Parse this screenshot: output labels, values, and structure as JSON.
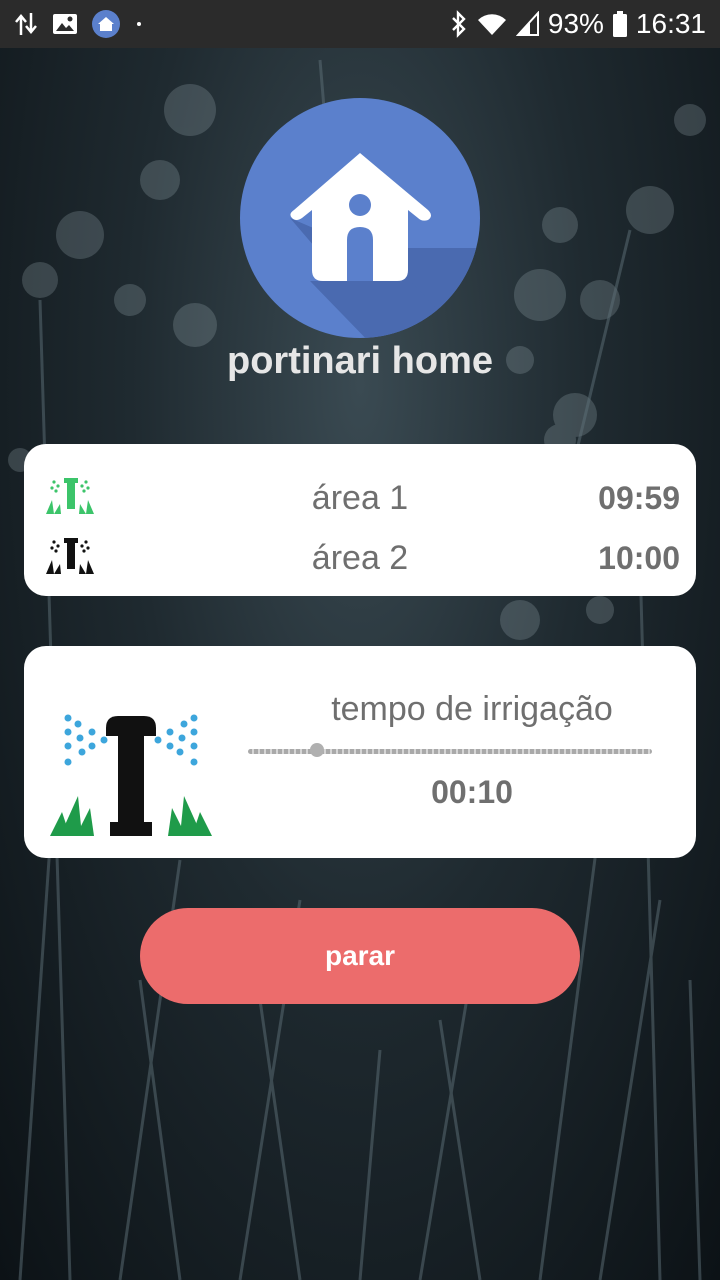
{
  "status_bar": {
    "left_icons": [
      "data-sync-icon",
      "image-icon",
      "app-home-icon",
      "dot-icon"
    ],
    "right_icons": [
      "bluetooth-icon",
      "wifi-icon",
      "signal-icon",
      "battery-icon"
    ],
    "battery": "93%",
    "time": "16:31"
  },
  "app": {
    "title": "portinari home",
    "logo_icon": "house-icon",
    "brand_color": "#5b80cc"
  },
  "areas": [
    {
      "name": "área 1",
      "time": "09:59",
      "icon": "sprinkler-active-icon",
      "icon_color": "#3cc46a"
    },
    {
      "name": "área 2",
      "time": "10:00",
      "icon": "sprinkler-idle-icon",
      "icon_color": "#111111"
    }
  ],
  "timer": {
    "label": "tempo de irrigação",
    "value": "00:10",
    "slider_fraction": 0.17,
    "icon": "sprinkler-icon"
  },
  "actions": {
    "stop_label": "parar",
    "stop_color": "#ec6c6c"
  }
}
